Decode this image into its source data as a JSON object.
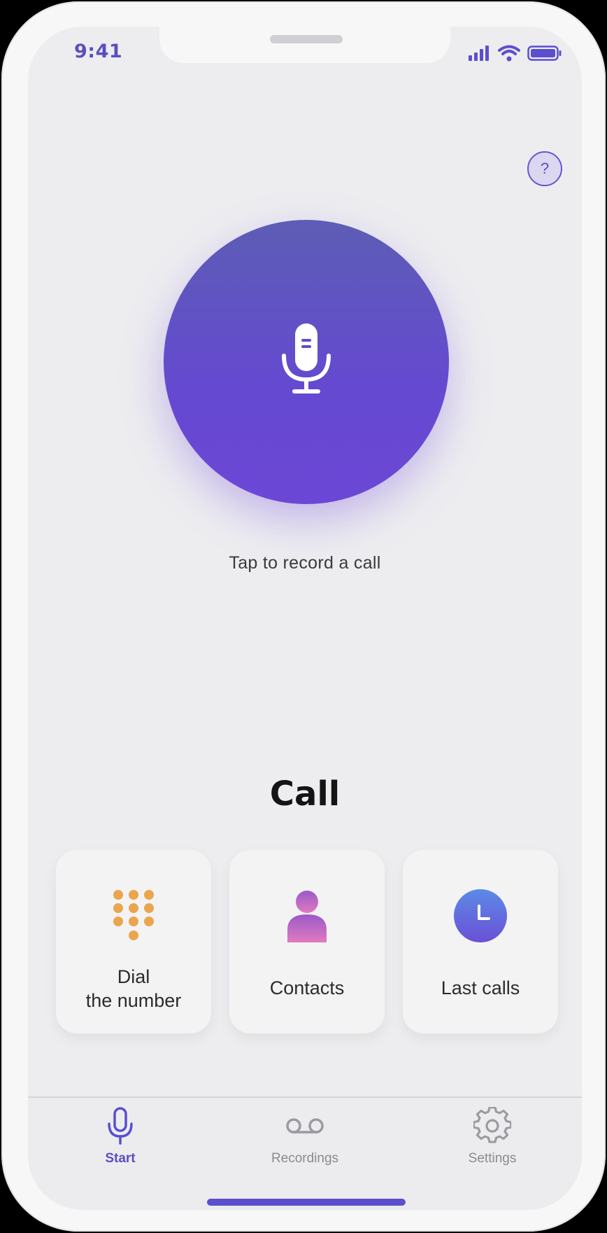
{
  "status_bar": {
    "time": "9:41"
  },
  "help": {
    "label": "?"
  },
  "record": {
    "label": "Tap to record a call",
    "icon": "microphone-icon"
  },
  "call_section": {
    "title": "Call",
    "cards": [
      {
        "line1": "Dial",
        "line2": "the number",
        "icon": "dialpad-icon"
      },
      {
        "label": "Contacts",
        "icon": "person-icon"
      },
      {
        "label": "Last calls",
        "icon": "clock-icon"
      }
    ]
  },
  "tabs": [
    {
      "label": "Start",
      "icon": "microphone-icon",
      "active": true
    },
    {
      "label": "Recordings",
      "icon": "voicemail-icon",
      "active": false
    },
    {
      "label": "Settings",
      "icon": "gear-icon",
      "active": false
    }
  ],
  "colors": {
    "accent": "#5a4ec1",
    "record_gradient_top": "#5d5db5",
    "record_gradient_bottom": "#6c47d6",
    "dialpad": "#e9a64f",
    "contact_top": "#9b59c9",
    "contact_bottom": "#e07ac0",
    "clock_top": "#5b8be6",
    "clock_bottom": "#6b4fd6",
    "inactive_tab": "#8a8a90"
  }
}
